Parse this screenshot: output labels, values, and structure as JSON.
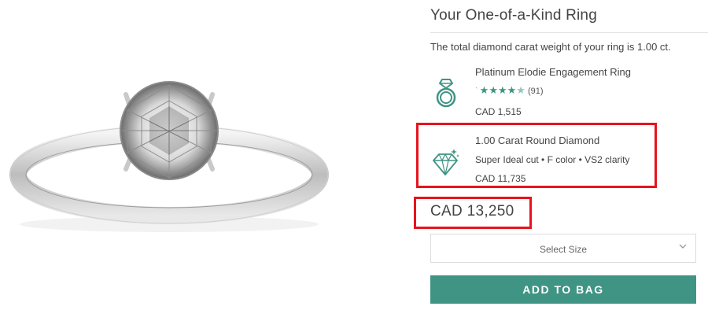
{
  "panel": {
    "title": "Your One-of-a-Kind Ring",
    "carat_note": "The total diamond carat weight of your ring is 1.00 ct."
  },
  "ring": {
    "name": "Platinum Elodie Engagement Ring",
    "rating_stars": 4.5,
    "stars_glyphs": "★★★★",
    "half_star": "★",
    "review_count": "(91)",
    "price": "CAD 1,515",
    "icon": "ring-icon"
  },
  "diamond": {
    "name": "1.00 Carat Round Diamond",
    "specs": "Super Ideal cut • F color • VS2 clarity",
    "price": "CAD 11,735",
    "icon": "diamond-icon"
  },
  "total": {
    "price": "CAD 13,250"
  },
  "size_select": {
    "label": "Select Size",
    "icon": "chevron-down-icon"
  },
  "add_button": {
    "label": "ADD TO BAG"
  },
  "colors": {
    "accent": "#3f9484",
    "highlight": "#e6141d",
    "text": "#444444"
  }
}
